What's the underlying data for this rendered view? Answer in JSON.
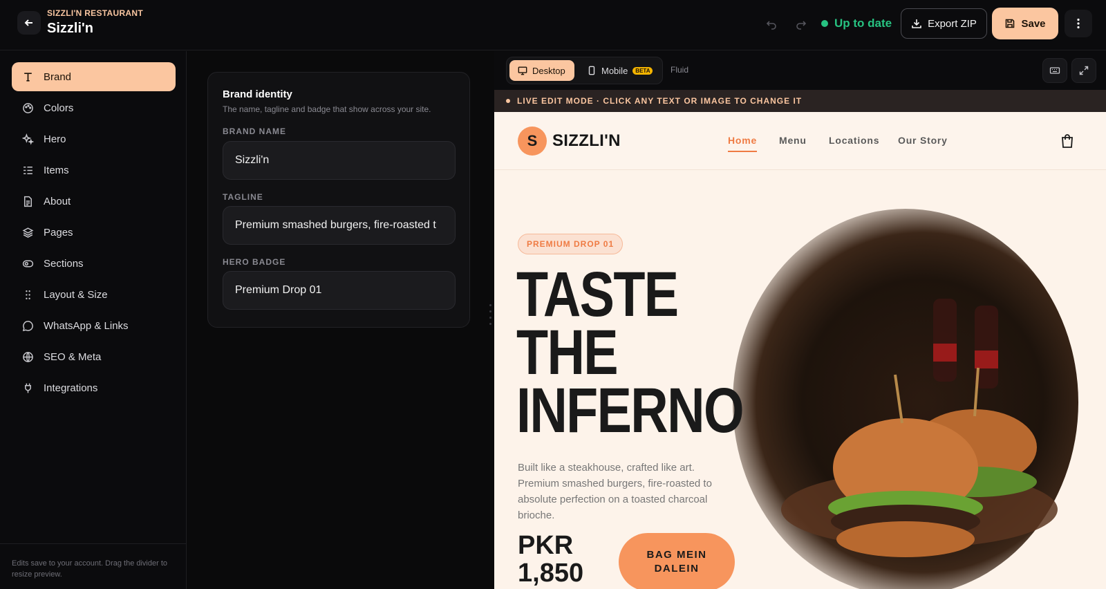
{
  "topbar": {
    "kicker": "SIZZLI'N RESTAURANT",
    "title": "Sizzli'n",
    "status": "Up to date",
    "export_label": "Export ZIP",
    "save_label": "Save"
  },
  "sidebar": {
    "items": [
      {
        "label": "Brand",
        "icon": "type-icon"
      },
      {
        "label": "Colors",
        "icon": "palette-icon"
      },
      {
        "label": "Hero",
        "icon": "sparkles-icon"
      },
      {
        "label": "Items",
        "icon": "list-icon"
      },
      {
        "label": "About",
        "icon": "document-icon"
      },
      {
        "label": "Pages",
        "icon": "layers-icon"
      },
      {
        "label": "Sections",
        "icon": "eye-icon"
      },
      {
        "label": "Layout & Size",
        "icon": "grip-icon"
      },
      {
        "label": "WhatsApp & Links",
        "icon": "chat-icon"
      },
      {
        "label": "SEO & Meta",
        "icon": "globe-icon"
      },
      {
        "label": "Integrations",
        "icon": "plug-icon"
      }
    ],
    "footer": "Edits save to your account. Drag the divider to resize preview."
  },
  "editor": {
    "card_title": "Brand identity",
    "card_sub": "The name, tagline and badge that show across your site.",
    "fields": {
      "brand_name": {
        "label": "BRAND NAME",
        "value": "Sizzli'n"
      },
      "tagline": {
        "label": "TAGLINE",
        "value": "Premium smashed burgers, fire-roasted t"
      },
      "hero_badge": {
        "label": "HERO BADGE",
        "value": "Premium Drop 01"
      }
    }
  },
  "preview": {
    "desktop_label": "Desktop",
    "mobile_label": "Mobile",
    "beta_label": "BETA",
    "fluid_label": "Fluid",
    "live_banner": "LIVE EDIT MODE · CLICK ANY TEXT OR IMAGE TO CHANGE IT"
  },
  "site": {
    "logo_letter": "S",
    "logo_text": "SIZZLI'N",
    "nav": [
      "Home",
      "Menu",
      "Locations",
      "Our Story"
    ],
    "badge": "PREMIUM DROP 01",
    "headline_1": "TASTE",
    "headline_2": "THE",
    "headline_3": "INFERNO",
    "description": "Built like a steakhouse, crafted like art. Premium smashed burgers, fire-roasted to absolute perfection on a toasted charcoal brioche.",
    "price_line_1": "PKR",
    "price_line_2": "1,850",
    "cta_line_1": "BAG MEIN",
    "cta_line_2": "DALEIN"
  },
  "colors": {
    "accent": "#fbc6a0",
    "status_green": "#27c281",
    "site_orange": "#f7955d"
  }
}
